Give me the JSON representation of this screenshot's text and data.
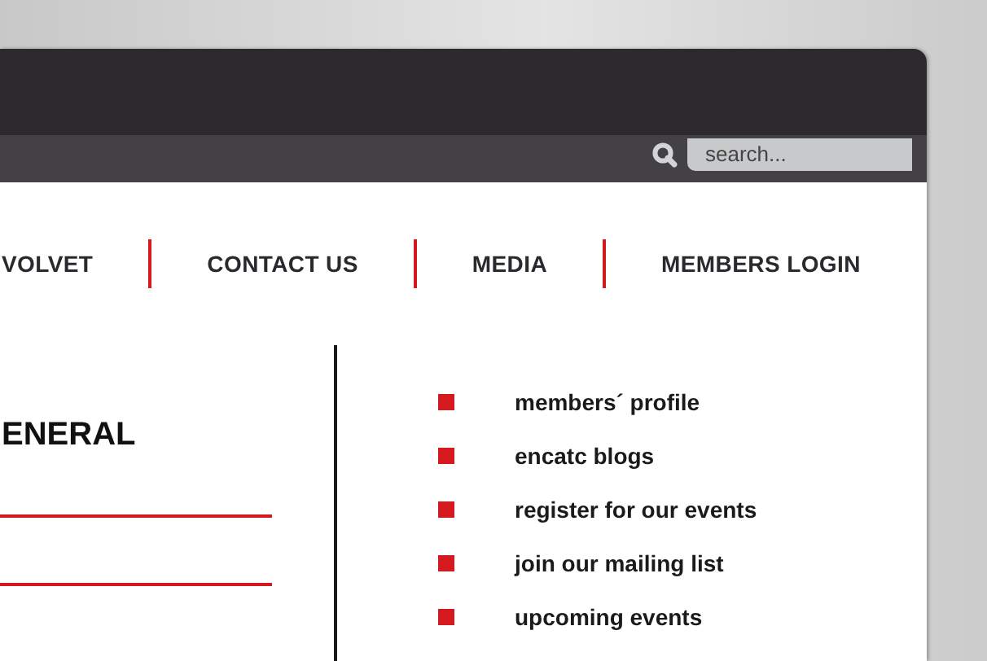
{
  "search": {
    "placeholder": "search..."
  },
  "nav": [
    {
      "label": "VOLVET"
    },
    {
      "label": "CONTACT US"
    },
    {
      "label": "MEDIA"
    },
    {
      "label": "MEMBERS LOGIN"
    }
  ],
  "heading": "ENERAL",
  "links": [
    "members´ profile",
    "encatc blogs",
    "register for our events",
    "join our mailing list",
    "upcoming events"
  ]
}
